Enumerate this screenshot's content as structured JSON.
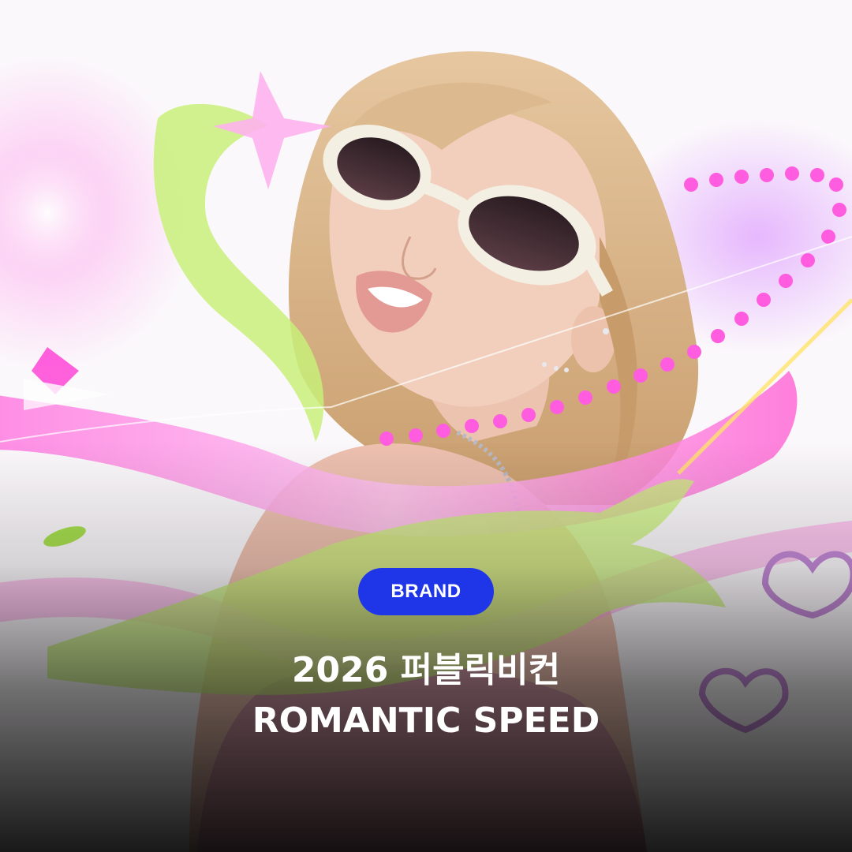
{
  "card": {
    "badge": "BRAND",
    "title_line1": "2026 퍼블릭비컨",
    "title_line2": "ROMANTIC SPEED"
  },
  "colors": {
    "badge_bg": "#1f36e8",
    "text": "#ffffff",
    "neon_pink": "#ff4fd8",
    "ribbon_pink": "#ffb6ef",
    "lime": "#c8f07a",
    "hair": "#d8b48a",
    "skin": "#f1cdb8",
    "sunglasses_frame": "#f4efe3"
  }
}
